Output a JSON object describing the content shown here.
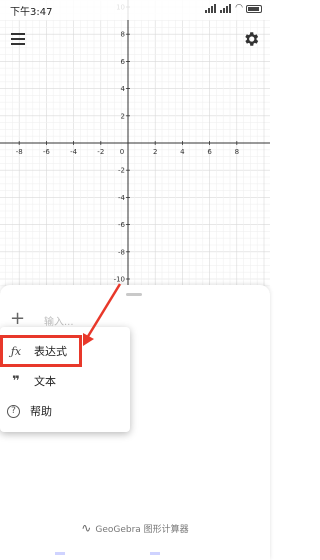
{
  "status_bar": {
    "time": "下午3:47",
    "battery": "88"
  },
  "graph": {
    "x_ticks": [
      "-8",
      "-6",
      "-4",
      "-2",
      "0",
      "2",
      "4",
      "6",
      "8"
    ],
    "y_ticks": [
      "10",
      "8",
      "6",
      "4",
      "2",
      "-2",
      "-4",
      "-6",
      "-8",
      "-10"
    ]
  },
  "input_bar": {
    "placeholder": "输入..."
  },
  "menu": {
    "items": [
      {
        "icon": "fx-icon",
        "label": "表达式"
      },
      {
        "icon": "quote-icon",
        "label": "文本"
      },
      {
        "icon": "help-icon",
        "label": "帮助"
      }
    ]
  },
  "footer": {
    "brand": "GeoGebra 图形计算器"
  },
  "colors": {
    "highlight": "#e8382a",
    "axis": "#333333",
    "grid_major": "#d9d9d9",
    "grid_minor": "#f0f0f0"
  }
}
